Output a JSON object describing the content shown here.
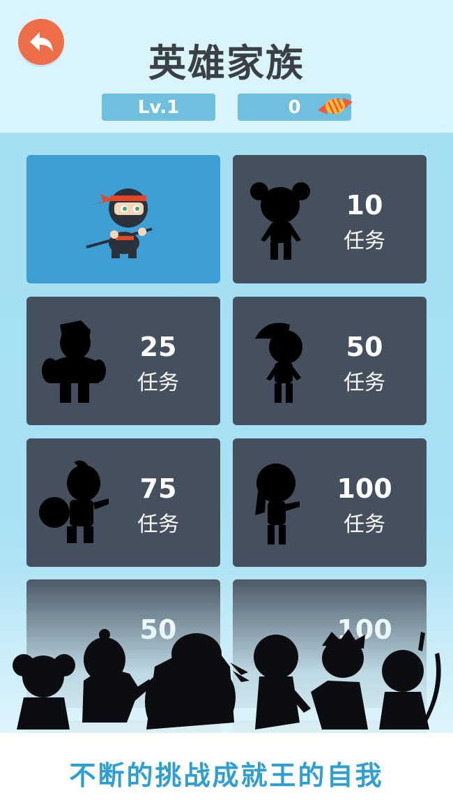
{
  "header": {
    "title": "英雄家族",
    "level_label": "Lv.1",
    "candy_count": "0"
  },
  "icons": {
    "back": "back-arrow-icon",
    "candy": "candy-icon",
    "ninja": "ninja-hero-icon",
    "locked": "silhouette-icon"
  },
  "heroes": [
    {
      "state": "unlocked"
    },
    {
      "count": "10",
      "unit": "任务"
    },
    {
      "count": "25",
      "unit": "任务"
    },
    {
      "count": "50",
      "unit": "任务"
    },
    {
      "count": "75",
      "unit": "任务"
    },
    {
      "count": "100",
      "unit": "任务"
    },
    {
      "count": "50"
    },
    {
      "count": "100"
    }
  ],
  "footer": {
    "slogan": "不断的挑战成就王的自我"
  },
  "colors": {
    "accent": "#3d9fd4",
    "locked_card": "#44505e",
    "back_button": "#ee6e4a",
    "slogan": "#2f9fd3"
  }
}
